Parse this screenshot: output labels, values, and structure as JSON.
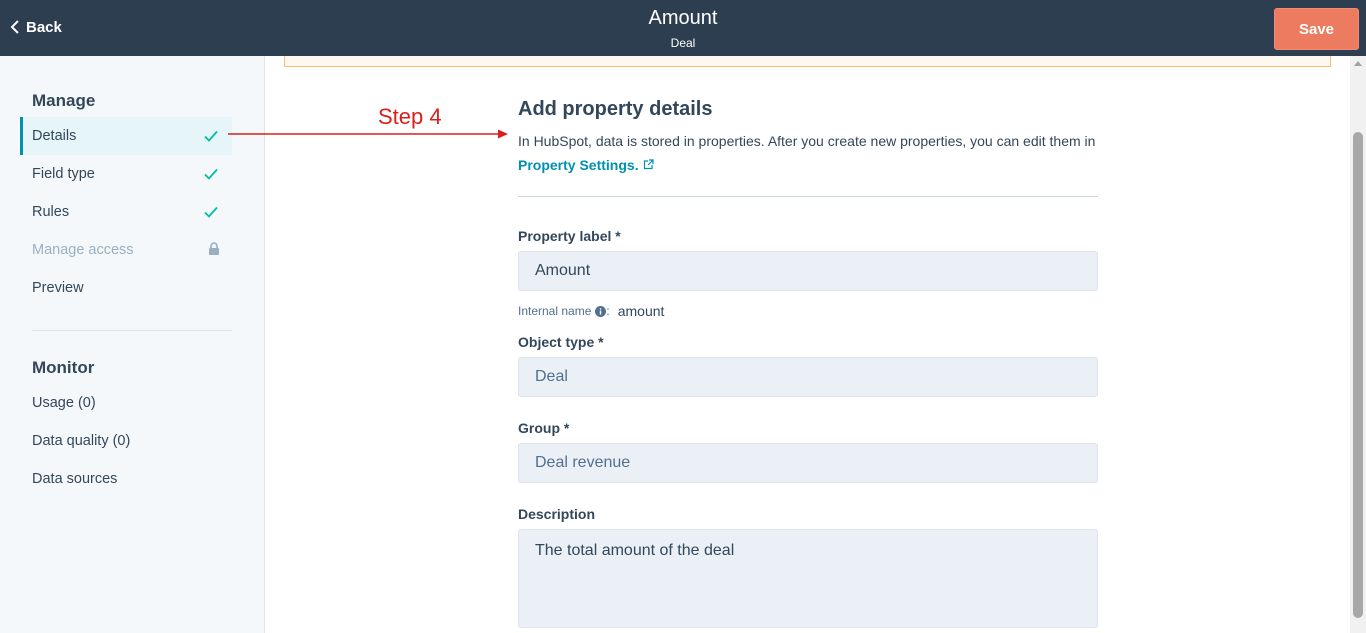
{
  "header": {
    "back_label": "Back",
    "title": "Amount",
    "subtitle": "Deal",
    "save_label": "Save"
  },
  "sidebar": {
    "manage_title": "Manage",
    "manage_items": [
      {
        "label": "Details",
        "status": "complete",
        "active": true
      },
      {
        "label": "Field type",
        "status": "complete"
      },
      {
        "label": "Rules",
        "status": "complete"
      },
      {
        "label": "Manage access",
        "status": "locked"
      },
      {
        "label": "Preview",
        "status": "none"
      }
    ],
    "monitor_title": "Monitor",
    "monitor_items": [
      {
        "label": "Usage (0)"
      },
      {
        "label": "Data quality (0)"
      },
      {
        "label": "Data sources"
      }
    ]
  },
  "annotation": {
    "step_label": "Step 4",
    "color": "#d9201e"
  },
  "main": {
    "heading": "Add property details",
    "intro_text": "In HubSpot, data is stored in properties. After you create new properties, you can edit them in ",
    "intro_link": "Property Settings.",
    "property_label": {
      "label": "Property label *",
      "value": "Amount"
    },
    "internal_name": {
      "label": "Internal name",
      "value": "amount"
    },
    "object_type": {
      "label": "Object type *",
      "value": "Deal"
    },
    "group": {
      "label": "Group *",
      "value": "Deal revenue"
    },
    "description": {
      "label": "Description",
      "value": "The total amount of the deal"
    }
  },
  "colors": {
    "header_bg": "#2d3e50",
    "save_button": "#ec7b5f",
    "link": "#0091ae",
    "check": "#00bda5"
  },
  "icons": {
    "back": "chevron-left-icon",
    "check": "checkmark-icon",
    "lock": "lock-icon",
    "info": "info-icon",
    "external": "external-link-icon"
  }
}
